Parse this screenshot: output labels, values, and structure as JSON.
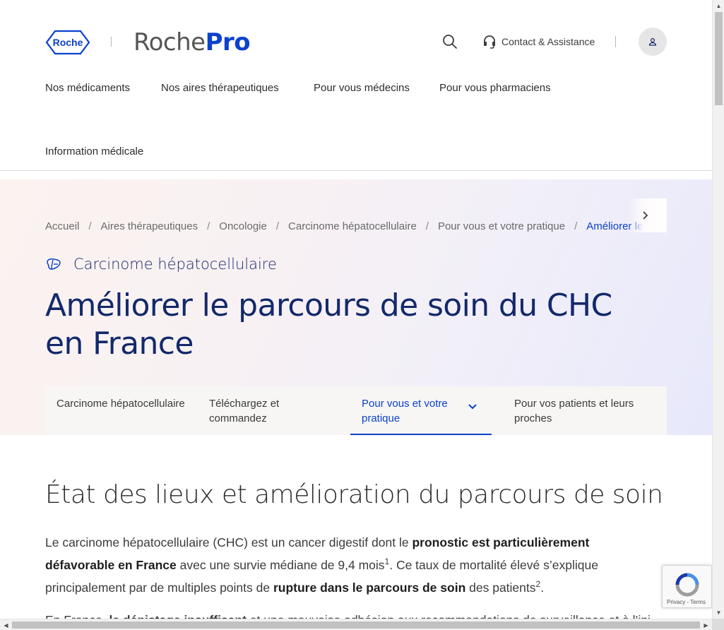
{
  "header": {
    "logo_text": "Roche",
    "brand_part1": "Roche",
    "brand_part2": "Pro",
    "contact_label": "Contact & Assistance",
    "search_icon": "search-icon",
    "headset_icon": "headset-icon",
    "user_icon": "user-icon"
  },
  "nav": {
    "items": [
      {
        "label": "Nos médicaments"
      },
      {
        "label": "Nos aires thérapeutiques"
      },
      {
        "label": "Pour vous médecins"
      },
      {
        "label": "Pour vous pharmaciens"
      },
      {
        "label": "Information médicale"
      }
    ]
  },
  "breadcrumb": {
    "items": [
      {
        "label": "Accueil"
      },
      {
        "label": "Aires thérapeutiques"
      },
      {
        "label": "Oncologie"
      },
      {
        "label": "Carcinome hépatocellulaire"
      },
      {
        "label": "Pour vous et votre pratique"
      },
      {
        "label": "Améliorer le parcours de soin du CHC en France"
      }
    ],
    "separator": "/"
  },
  "hero": {
    "topic_label": "Carcinome hépatocellulaire",
    "topic_icon": "liver-icon",
    "title": "Améliorer le parcours de soin du CHC en France"
  },
  "subnav": {
    "items": [
      {
        "label": "Carcinome hépatocellulaire"
      },
      {
        "label": "Téléchargez et commandez"
      },
      {
        "label": "Pour vous et votre pratique"
      },
      {
        "label": "Pour vos patients et leurs proches"
      }
    ],
    "active_index": 2
  },
  "content": {
    "heading": "État des lieux et amélioration du parcours de soin",
    "p1": {
      "t1": "Le carcinome hépatocellulaire (CHC) est un cancer digestif dont le ",
      "b1": "pronostic est particulièrement défavorable en France",
      "t2": " avec une survie médiane de 9,4 mois",
      "sup1": "1",
      "t3": ". Ce taux de mortalité élevé s’explique principalement par de multiples points de ",
      "b2": "rupture dans le parcours de soin",
      "t4": " des patients",
      "sup2": "2",
      "t5": "."
    },
    "p2_partial": {
      "t1": "En France, ",
      "b1": "le dépistage insuffisant",
      "t2": " et une mauvaise adhésion aux recommandations de surveillance et à l’ini"
    }
  },
  "recaptcha": {
    "links": "Privacy - Terms"
  }
}
